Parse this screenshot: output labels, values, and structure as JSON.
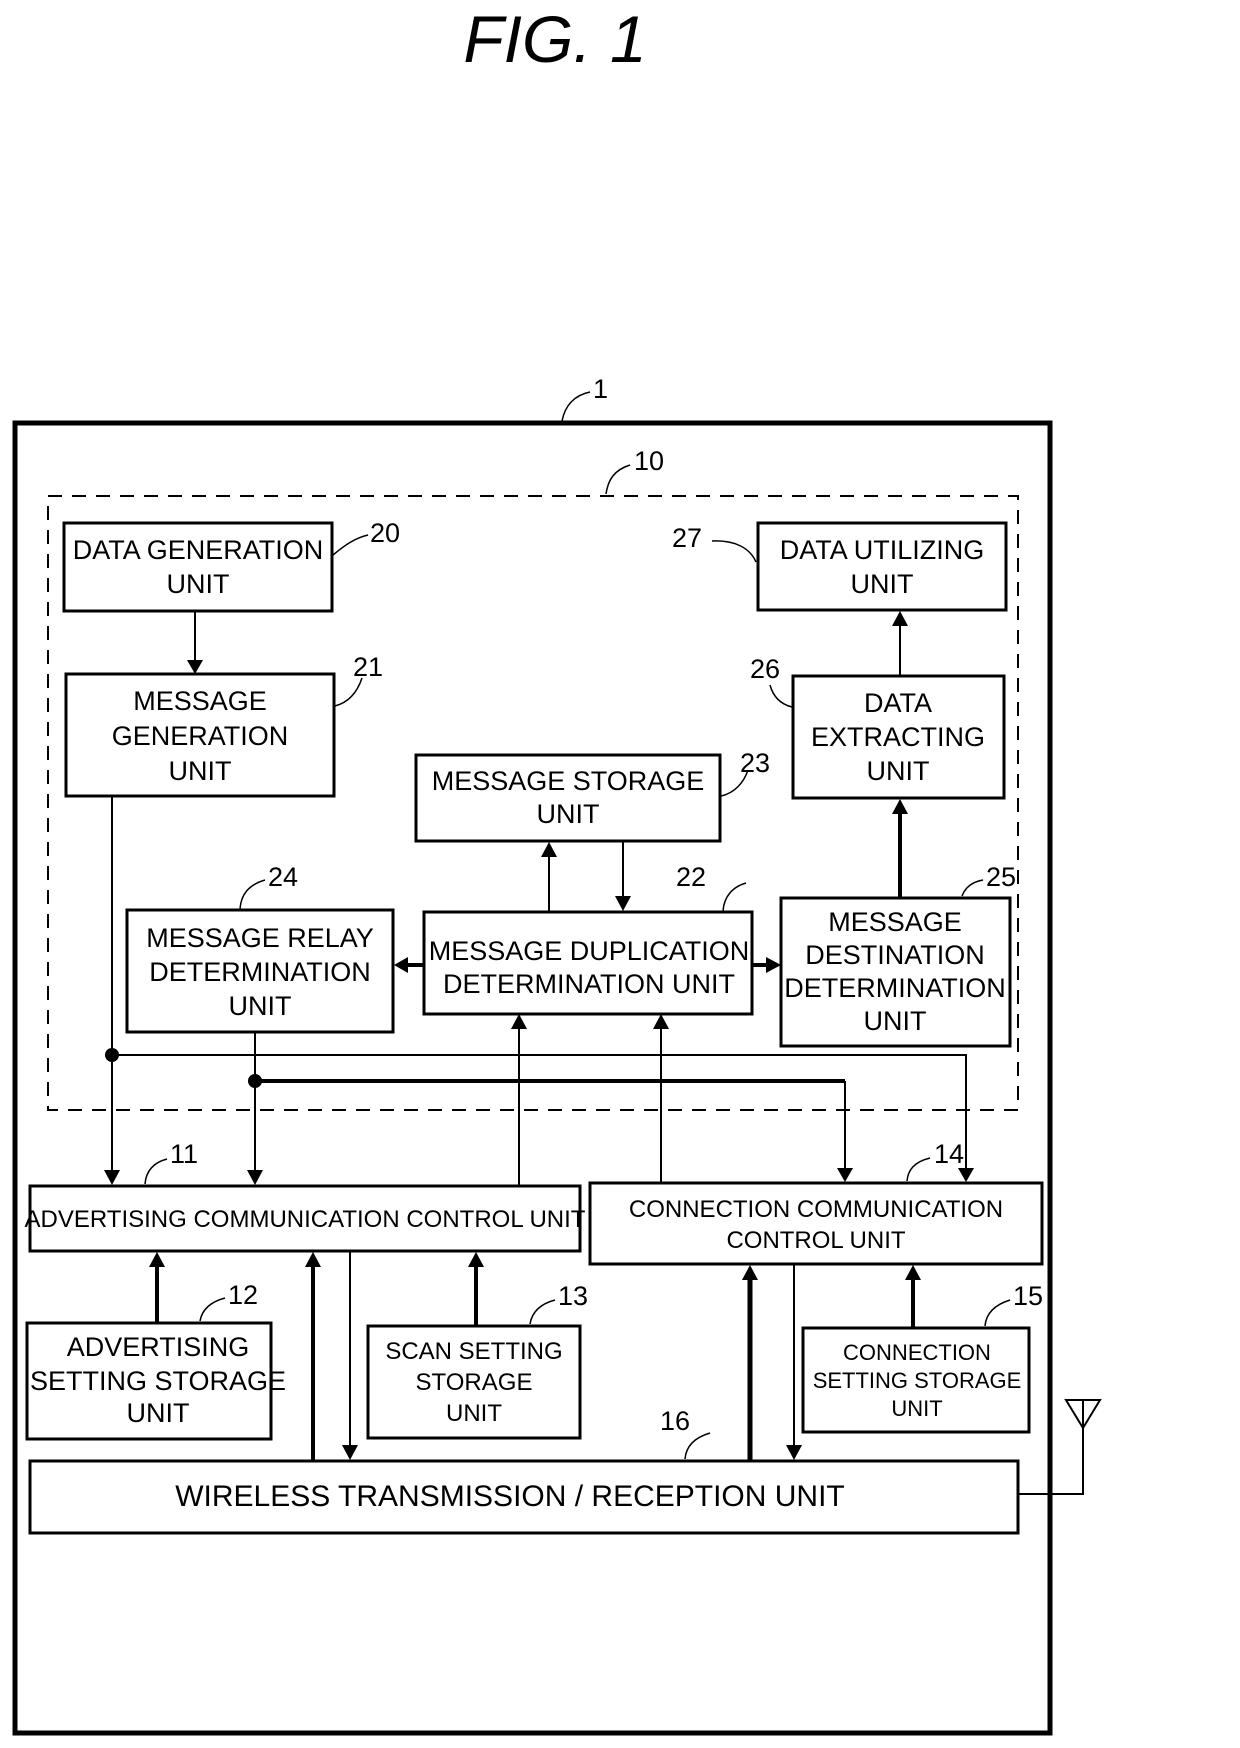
{
  "figure": {
    "title": "FIG.  1"
  },
  "device": {
    "ref": "1"
  },
  "controller": {
    "ref": "10"
  },
  "units": {
    "data_generation": {
      "ref": "20",
      "lines": [
        "DATA GENERATION",
        "UNIT"
      ]
    },
    "message_generation": {
      "ref": "21",
      "lines": [
        "MESSAGE",
        "GENERATION",
        "UNIT"
      ]
    },
    "message_duplication": {
      "ref": "22",
      "lines": [
        "MESSAGE DUPLICATION",
        "DETERMINATION UNIT"
      ]
    },
    "message_storage": {
      "ref": "23",
      "lines": [
        "MESSAGE STORAGE",
        "UNIT"
      ]
    },
    "message_relay": {
      "ref": "24",
      "lines": [
        "MESSAGE RELAY",
        "DETERMINATION",
        "UNIT"
      ]
    },
    "message_destination": {
      "ref": "25",
      "lines": [
        "MESSAGE",
        "DESTINATION",
        "DETERMINATION",
        "UNIT"
      ]
    },
    "data_extracting": {
      "ref": "26",
      "lines": [
        "DATA",
        "EXTRACTING",
        "UNIT"
      ]
    },
    "data_utilizing": {
      "ref": "27",
      "lines": [
        "DATA UTILIZING",
        "UNIT"
      ]
    },
    "advertising_comm": {
      "ref": "11",
      "lines": [
        "ADVERTISING COMMUNICATION CONTROL UNIT"
      ]
    },
    "advertising_setting": {
      "ref": "12",
      "lines": [
        "ADVERTISING",
        "SETTING STORAGE",
        "UNIT"
      ]
    },
    "scan_setting": {
      "ref": "13",
      "lines": [
        "SCAN SETTING",
        "STORAGE",
        "UNIT"
      ]
    },
    "connection_comm": {
      "ref": "14",
      "lines": [
        "CONNECTION COMMUNICATION",
        "CONTROL UNIT"
      ]
    },
    "connection_setting": {
      "ref": "15",
      "lines": [
        "CONNECTION",
        "SETTING STORAGE",
        "UNIT"
      ]
    },
    "wireless": {
      "ref": "16",
      "lines": [
        "WIRELESS TRANSMISSION / RECEPTION UNIT"
      ]
    }
  },
  "icons": {
    "antenna": "antenna-icon"
  }
}
